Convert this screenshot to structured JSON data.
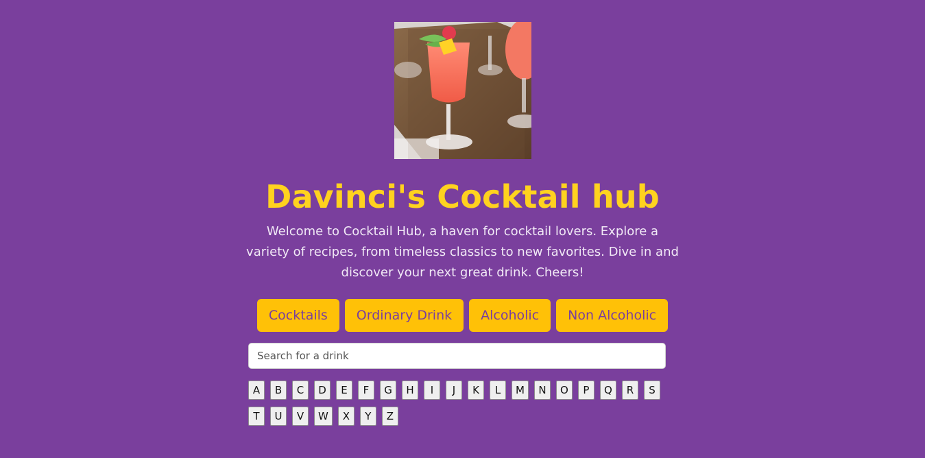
{
  "hero": {
    "image_alt": "cocktail-image"
  },
  "header": {
    "title": "Davinci's Cocktail hub",
    "description": "Welcome to Cocktail Hub, a haven for cocktail lovers. Explore a variety of recipes, from timeless classics to new favorites. Dive in and discover your next great drink. Cheers!"
  },
  "filters": [
    {
      "label": "Cocktails"
    },
    {
      "label": "Ordinary Drink"
    },
    {
      "label": "Alcoholic"
    },
    {
      "label": "Non Alcoholic"
    }
  ],
  "search": {
    "placeholder": "Search for a drink",
    "value": ""
  },
  "letters": [
    "A",
    "B",
    "C",
    "D",
    "E",
    "F",
    "G",
    "H",
    "I",
    "J",
    "K",
    "L",
    "M",
    "N",
    "O",
    "P",
    "Q",
    "R",
    "S",
    "T",
    "U",
    "V",
    "W",
    "X",
    "Y",
    "Z"
  ],
  "colors": {
    "background": "#7a3f9d",
    "accent": "#ffd21f",
    "button": "#ffc107"
  }
}
